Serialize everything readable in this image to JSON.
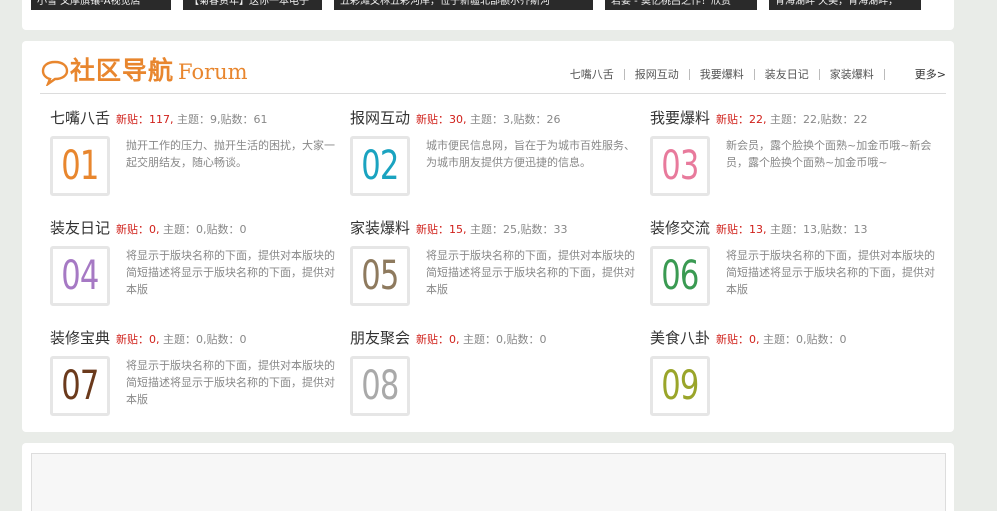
{
  "top_strip": {
    "items": [
      "小雪 文摩旗镶-A视觉店",
      "【菊春资年】送你一本电子",
      "五彩滩文林五彩河岸，位于新疆北部额尔齐斯河",
      "君要 - 莫忆桃吕之作！欣赏",
      "青海湖畔 天美，青海湖畔，"
    ]
  },
  "header": {
    "title_cn": "社区导航",
    "title_en": "Forum",
    "nav": [
      "七嘴八舌",
      "报网互动",
      "我要爆料",
      "装友日记",
      "家装爆料"
    ],
    "more": "更多>"
  },
  "labels": {
    "new_prefix": "新贴：",
    "topics_prefix": "主题：",
    "posts_prefix": "贴数："
  },
  "boards": [
    {
      "name": "七嘴八舌",
      "new": "新贴：117,",
      "stats": "主题：9,贴数：61",
      "number": "01",
      "color": "#e8862e",
      "desc": "抛开工作的压力、抛开生活的困扰，大家一起交朋结友，随心畅谈。"
    },
    {
      "name": "报网互动",
      "new": "新贴：30,",
      "stats": "主题：3,贴数：26",
      "number": "02",
      "color": "#1aa3c0",
      "desc": "城市便民信息网，旨在于为城市百姓服务、为城市朋友提供方便迅捷的信息。"
    },
    {
      "name": "我要爆料",
      "new": "新贴：22,",
      "stats": "主题：22,贴数：22",
      "number": "03",
      "color": "#e87a9c",
      "desc": "新会员，露个脸换个面熟~加金币哦~新会员，露个脸换个面熟~加金币哦~"
    },
    {
      "name": "装友日记",
      "new": "新贴：0,",
      "stats": "主题：0,贴数：0",
      "number": "04",
      "color": "#a679c4",
      "desc": "将显示于版块名称的下面，提供对本版块的简短描述将显示于版块名称的下面，提供对本版"
    },
    {
      "name": "家装爆料",
      "new": "新贴：15,",
      "stats": "主题：25,贴数：33",
      "number": "05",
      "color": "#8e7a5e",
      "desc": "将显示于版块名称的下面，提供对本版块的简短描述将显示于版块名称的下面，提供对本版"
    },
    {
      "name": "装修交流",
      "new": "新贴：13,",
      "stats": "主题：13,贴数：13",
      "number": "06",
      "color": "#3a9a52",
      "desc": "将显示于版块名称的下面，提供对本版块的简短描述将显示于版块名称的下面，提供对本版"
    },
    {
      "name": "装修宝典",
      "new": "新贴：0,",
      "stats": "主题：0,贴数：0",
      "number": "07",
      "color": "#6b3a1c",
      "desc": "将显示于版块名称的下面，提供对本版块的简短描述将显示于版块名称的下面，提供对本版"
    },
    {
      "name": "朋友聚会",
      "new": "新贴：0,",
      "stats": "主题：0,贴数：0",
      "number": "08",
      "color": "#a9a9a9",
      "desc": ""
    },
    {
      "name": "美食八卦",
      "new": "新贴：0,",
      "stats": "主题：0,贴数：0",
      "number": "09",
      "color": "#9aa52a",
      "desc": ""
    }
  ]
}
